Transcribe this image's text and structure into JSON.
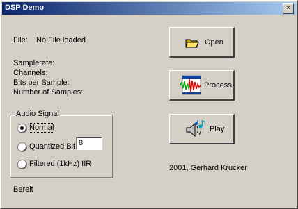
{
  "window": {
    "title": "DSP Demo",
    "close_glyph": "×"
  },
  "file": {
    "label": "File:",
    "value": "No File loaded"
  },
  "info": {
    "samplerate": "Samplerate:",
    "channels": "Channels:",
    "bits_per_sample": "Bits per Sample:",
    "number_of_samples": "Number of Samples:"
  },
  "audio_signal": {
    "title": "Audio Signal",
    "options": [
      {
        "label": "Normal",
        "selected": true
      },
      {
        "label": "Quantized Bit",
        "selected": false
      },
      {
        "label": "Filtered (1kHz) IIR",
        "selected": false
      }
    ],
    "quantized_bits": "8"
  },
  "buttons": {
    "open": {
      "label": "Open",
      "icon": "folder-open-icon"
    },
    "process": {
      "label": "Process",
      "icon": "waveform-icon"
    },
    "play": {
      "label": "Play",
      "icon": "speaker-icon"
    }
  },
  "credit": "2001, Gerhard Krucker",
  "status": "Bereit"
}
